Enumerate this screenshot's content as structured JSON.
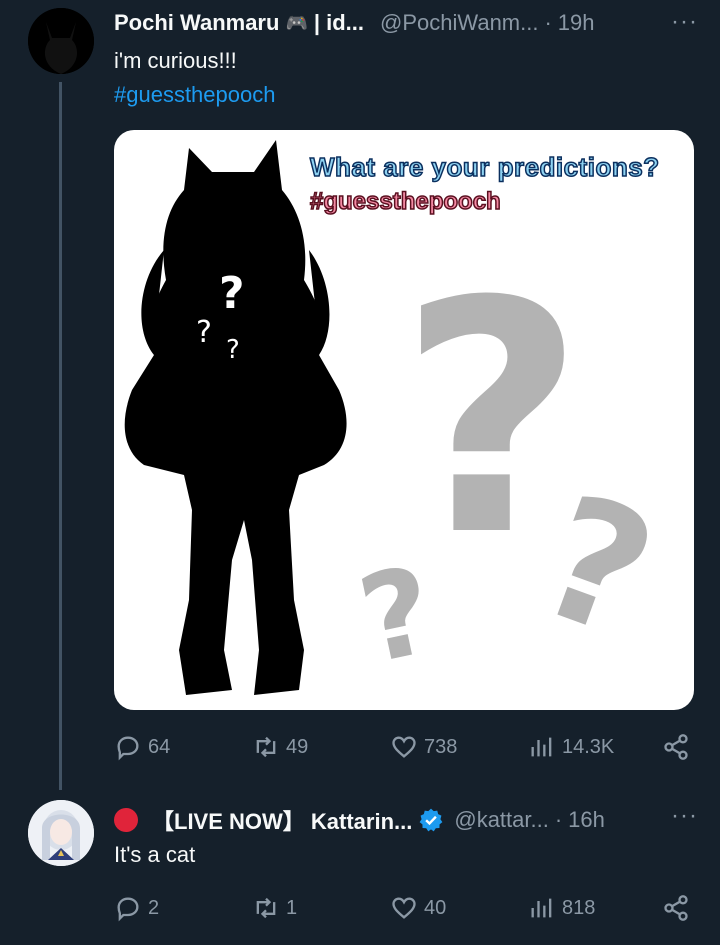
{
  "tweet1": {
    "name": "Pochi Wanmaru",
    "name_suffix": "| id...",
    "emoji": "🎮",
    "handle": "@PochiWanm...",
    "dot": "·",
    "time": "19h",
    "more": "···",
    "text": "i'm curious!!!",
    "hashtag": "#guessthepooch",
    "media": {
      "line1": "What are your predictions?",
      "line2": "#guessthepooch"
    },
    "stats": {
      "replies": "64",
      "retweets": "49",
      "likes": "738",
      "views": "14.3K"
    }
  },
  "tweet2": {
    "name": "【LIVE NOW】 Kattarin...",
    "handle": "@kattar...",
    "dot": "·",
    "time": "16h",
    "more": "···",
    "text": "It's a cat",
    "stats": {
      "replies": "2",
      "retweets": "1",
      "likes": "40",
      "views": "818"
    }
  },
  "colors": {
    "background": "#15202b",
    "accent": "#1d9bf0",
    "muted": "#8b98a5",
    "live": "#e0243a"
  },
  "icons": [
    "reply-icon",
    "retweet-icon",
    "like-icon",
    "views-icon",
    "share-icon",
    "verified-icon",
    "more-icon"
  ]
}
